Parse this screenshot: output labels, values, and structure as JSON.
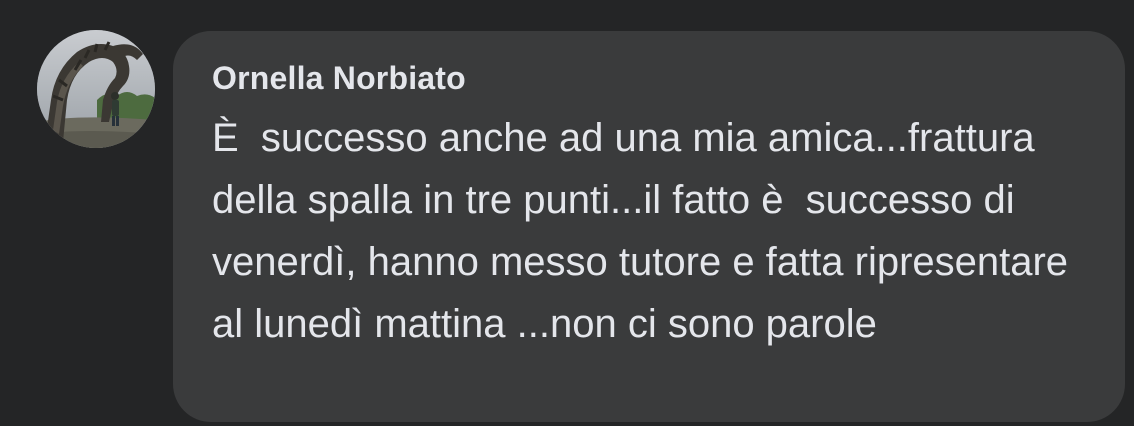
{
  "comment": {
    "author": "Ornella Norbiato",
    "text": "È  successo anche ad una mia amica...frattura della spalla in tre punti...il fatto è  successo di venerdì, hanno messo tutore e fatta ripresentare al lunedì mattina ...non ci sono parole"
  },
  "colors": {
    "page_background": "#242526",
    "bubble_background": "#3a3b3c",
    "text": "#e4e6eb"
  }
}
